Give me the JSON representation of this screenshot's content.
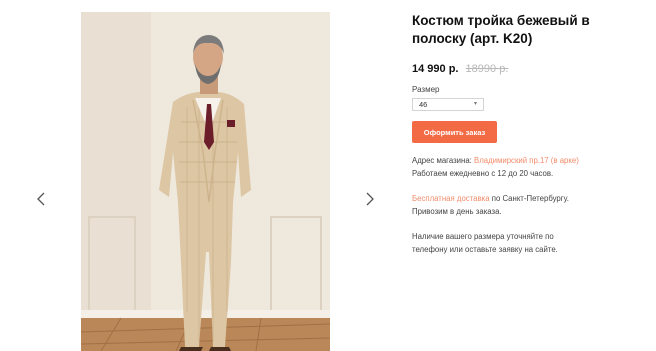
{
  "product": {
    "title": "Костюм тройка бежевый в полоску (арт. K20)",
    "price": "14 990 р.",
    "old_price": "18990 р."
  },
  "size": {
    "label": "Размер",
    "selected": "46"
  },
  "order_button": "Оформить заказ",
  "store": {
    "address_prefix": "Адрес магазина: ",
    "address_link": "Владимирский пр.17 (в арке)",
    "hours": "Работаем ежедневно с 12 до 20 часов."
  },
  "delivery": {
    "link": "Бесплатная доставка",
    "text": " по Санкт-Петербургу.",
    "line2": "Привозим в день заказа."
  },
  "note": "Наличие вашего размера уточняйте по телефону или оставьте заявку на сайте.",
  "colors": {
    "accent": "#f26b45",
    "link": "#f28b6a",
    "old_price": "#b8b8b8"
  },
  "icons": {
    "prev": "chevron-left-icon",
    "next": "chevron-right-icon",
    "select": "chevron-down-icon"
  }
}
